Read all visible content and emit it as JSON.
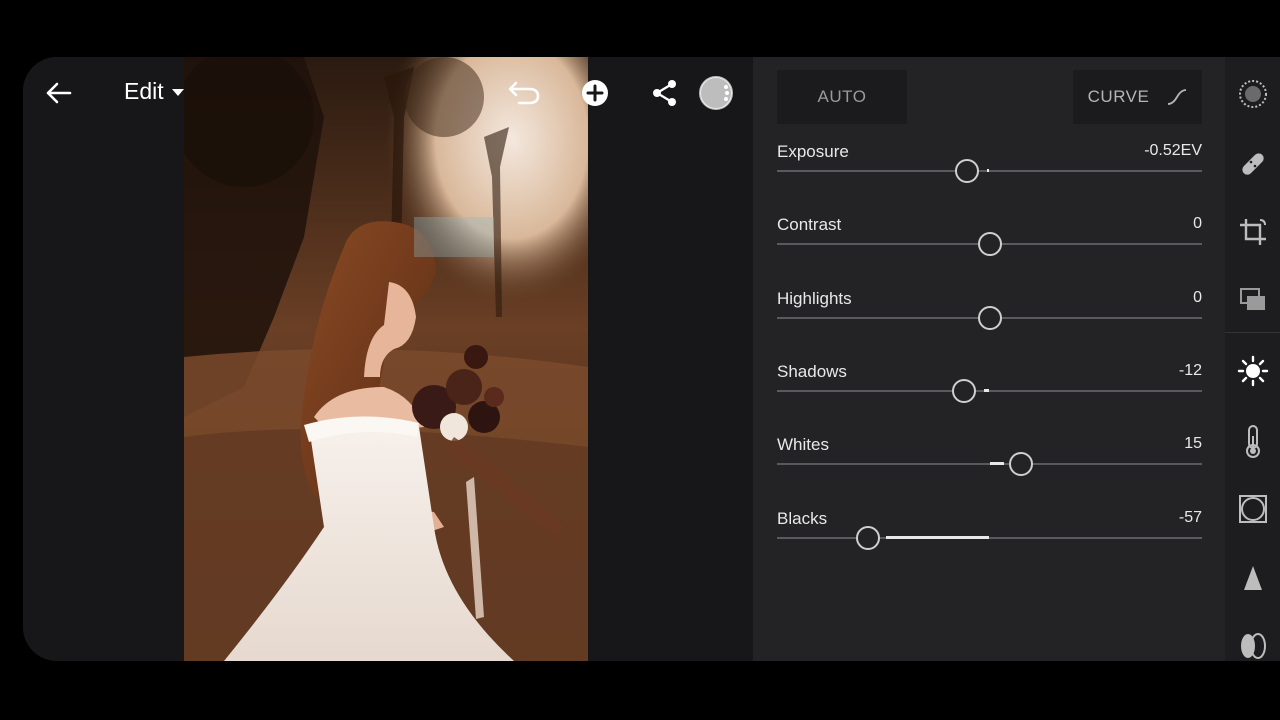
{
  "toolbar": {
    "edit_label": "Edit"
  },
  "panel": {
    "auto_label": "AUTO",
    "curve_label": "CURVE",
    "sliders": [
      {
        "label": "Exposure",
        "value": "-0.52EV",
        "position": 0.446,
        "fill_from": 0.5,
        "fill_to": 0.493
      },
      {
        "label": "Contrast",
        "value": "0",
        "position": 0.5,
        "fill_from": 0.5,
        "fill_to": 0.5
      },
      {
        "label": "Highlights",
        "value": "0",
        "position": 0.5,
        "fill_from": 0.5,
        "fill_to": 0.5
      },
      {
        "label": "Shadows",
        "value": "-12",
        "position": 0.44,
        "fill_from": 0.5,
        "fill_to": 0.487
      },
      {
        "label": "Whites",
        "value": "15",
        "position": 0.575,
        "fill_from": 0.5,
        "fill_to": 0.533
      },
      {
        "label": "Blacks",
        "value": "-57",
        "position": 0.215,
        "fill_from": 0.5,
        "fill_to": 0.257
      }
    ]
  },
  "rail": {
    "items": [
      "presets-icon",
      "healing-icon",
      "crop-icon",
      "layers-icon",
      "light-icon",
      "temperature-icon",
      "vignette-icon",
      "detail-icon",
      "optics-icon"
    ],
    "active": "light-icon"
  },
  "colors": {
    "panel_bg": "#232326",
    "accent": "#e8e8e8"
  }
}
